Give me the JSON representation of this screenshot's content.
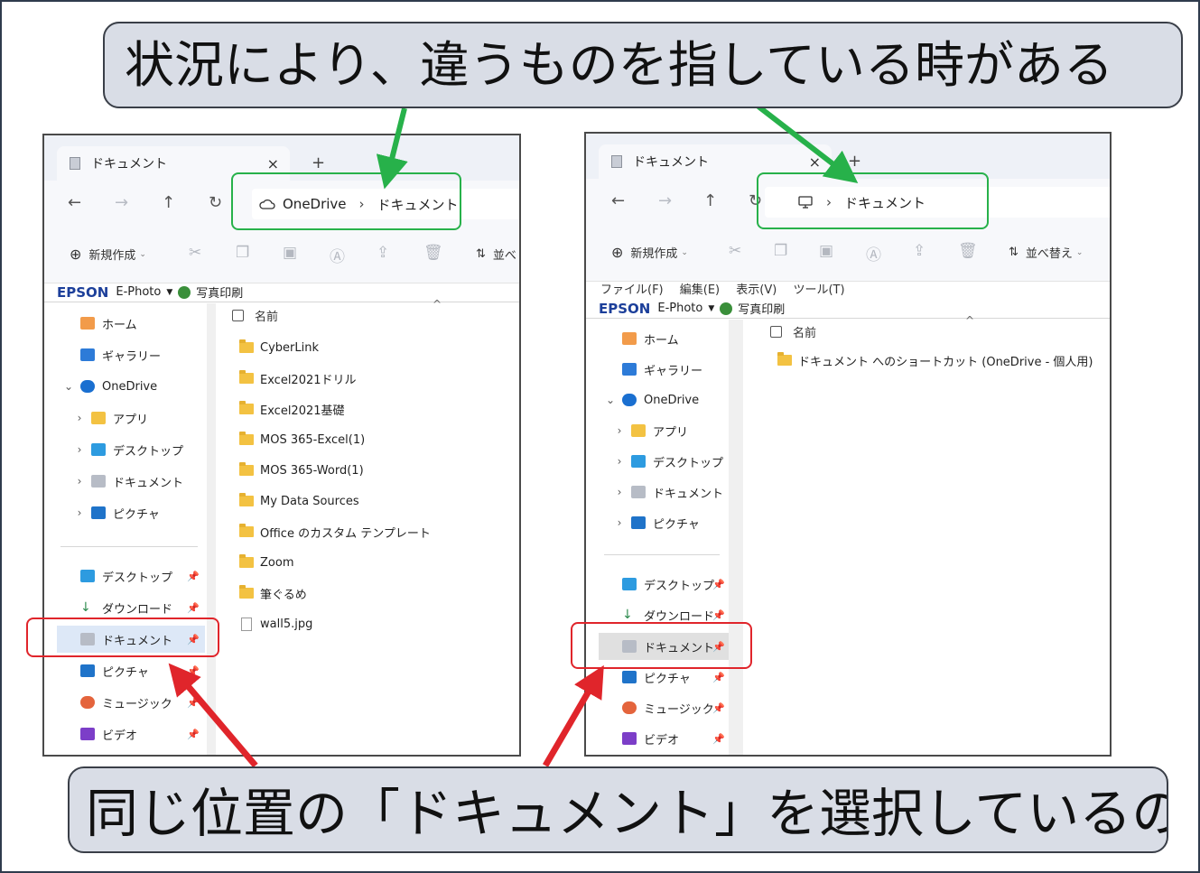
{
  "callouts": {
    "top": "状況により、違うものを指している時がある",
    "bottom": "同じ位置の「ドキュメント」を選択しているのに"
  },
  "left_window": {
    "tab_title": "ドキュメント",
    "tab_close": "×",
    "new_tab": "+",
    "address": {
      "location": "OneDrive",
      "separator": "›",
      "folder": "ドキュメント"
    },
    "new_button": "新規作成",
    "sort_label": "並べ",
    "epson": {
      "brand": "EPSON",
      "app": "E-Photo",
      "print": "写真印刷"
    },
    "column_name": "名前",
    "sidebar": {
      "home": "ホーム",
      "gallery": "ギャラリー",
      "onedrive": "OneDrive",
      "apps": "アプリ",
      "desktop": "デスクトップ",
      "documents": "ドキュメント",
      "pictures": "ピクチャ",
      "quick": {
        "desktop": "デスクトップ",
        "downloads": "ダウンロード",
        "documents": "ドキュメント",
        "pictures": "ピクチャ",
        "music": "ミュージック",
        "videos": "ビデオ"
      }
    },
    "files": [
      "CyberLink",
      "Excel2021ドリル",
      "Excel2021基礎",
      "MOS 365-Excel(1)",
      "MOS 365-Word(1)",
      "My Data Sources",
      "Office のカスタム テンプレート",
      "Zoom",
      "筆ぐるめ",
      "wall5.jpg"
    ]
  },
  "right_window": {
    "tab_title": "ドキュメント",
    "tab_close": "×",
    "new_tab": "+",
    "address": {
      "separator": "›",
      "folder": "ドキュメント"
    },
    "new_button": "新規作成",
    "sort_label": "並べ替え",
    "menu": [
      "ファイル(F)",
      "編集(E)",
      "表示(V)",
      "ツール(T)"
    ],
    "epson": {
      "brand": "EPSON",
      "app": "E-Photo",
      "print": "写真印刷"
    },
    "column_name": "名前",
    "sidebar": {
      "home": "ホーム",
      "gallery": "ギャラリー",
      "onedrive": "OneDrive",
      "apps": "アプリ",
      "desktop": "デスクトップ",
      "documents": "ドキュメント",
      "pictures": "ピクチャ",
      "quick": {
        "desktop": "デスクトップ",
        "downloads": "ダウンロード",
        "documents": "ドキュメント",
        "pictures": "ピクチャ",
        "music": "ミュージック",
        "videos": "ビデオ"
      }
    },
    "files": [
      "ドキュメント へのショートカット (OneDrive - 個人用)"
    ]
  },
  "colors": {
    "green_annotation": "#27b14a",
    "red_annotation": "#e0252b",
    "callout_fill": "#d9dde6"
  },
  "icons": [
    "document-icon",
    "back-arrow-icon",
    "forward-arrow-icon",
    "up-arrow-icon",
    "refresh-icon",
    "cloud-icon",
    "monitor-icon",
    "plus-circle-icon",
    "cut-icon",
    "copy-icon",
    "paste-icon",
    "rename-icon",
    "share-icon",
    "delete-icon",
    "sort-icon",
    "home-icon",
    "gallery-icon",
    "onedrive-cloud-icon",
    "folder-icon",
    "desktop-icon",
    "documents-icon",
    "pictures-icon",
    "download-icon",
    "music-icon",
    "video-icon",
    "pin-icon",
    "shortcut-folder-icon",
    "image-file-icon"
  ]
}
